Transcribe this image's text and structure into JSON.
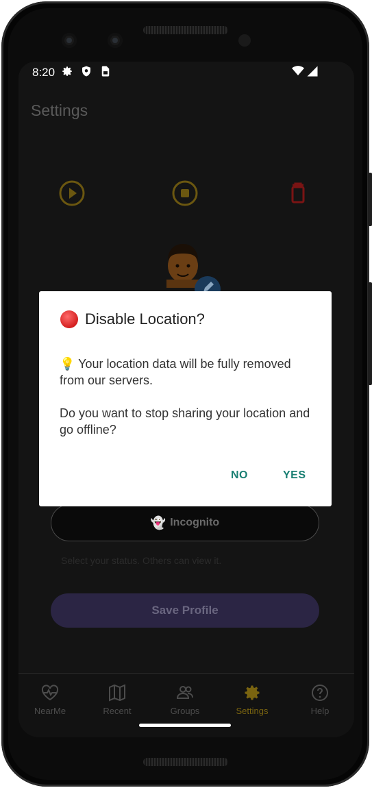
{
  "status_bar": {
    "time": "8:20"
  },
  "app": {
    "title": "Settings"
  },
  "actions": {
    "play": "play-circle-icon",
    "stop": "stop-circle-icon",
    "delete": "trash-icon"
  },
  "profile": {
    "incognito_label": "Incognito",
    "status_hint": "Select your status. Others can view it.",
    "save_label": "Save Profile"
  },
  "nav": {
    "items": [
      {
        "label": "NearMe",
        "icon": "heart-pulse-icon"
      },
      {
        "label": "Recent",
        "icon": "map-icon"
      },
      {
        "label": "Groups",
        "icon": "people-icon"
      },
      {
        "label": "Settings",
        "icon": "gear-icon",
        "active": true
      },
      {
        "label": "Help",
        "icon": "help-circle-icon"
      }
    ]
  },
  "dialog": {
    "title": "Disable Location?",
    "message_1": "💡 Your location data will be fully removed from our servers.",
    "message_2": "Do you want to stop sharing your location and go offline?",
    "no_label": "NO",
    "yes_label": "YES"
  },
  "colors": {
    "accent_yellow": "#7a6410",
    "danger_red": "#8a1212",
    "dialog_button": "#1a7f73",
    "save_button": "#2b2544"
  }
}
